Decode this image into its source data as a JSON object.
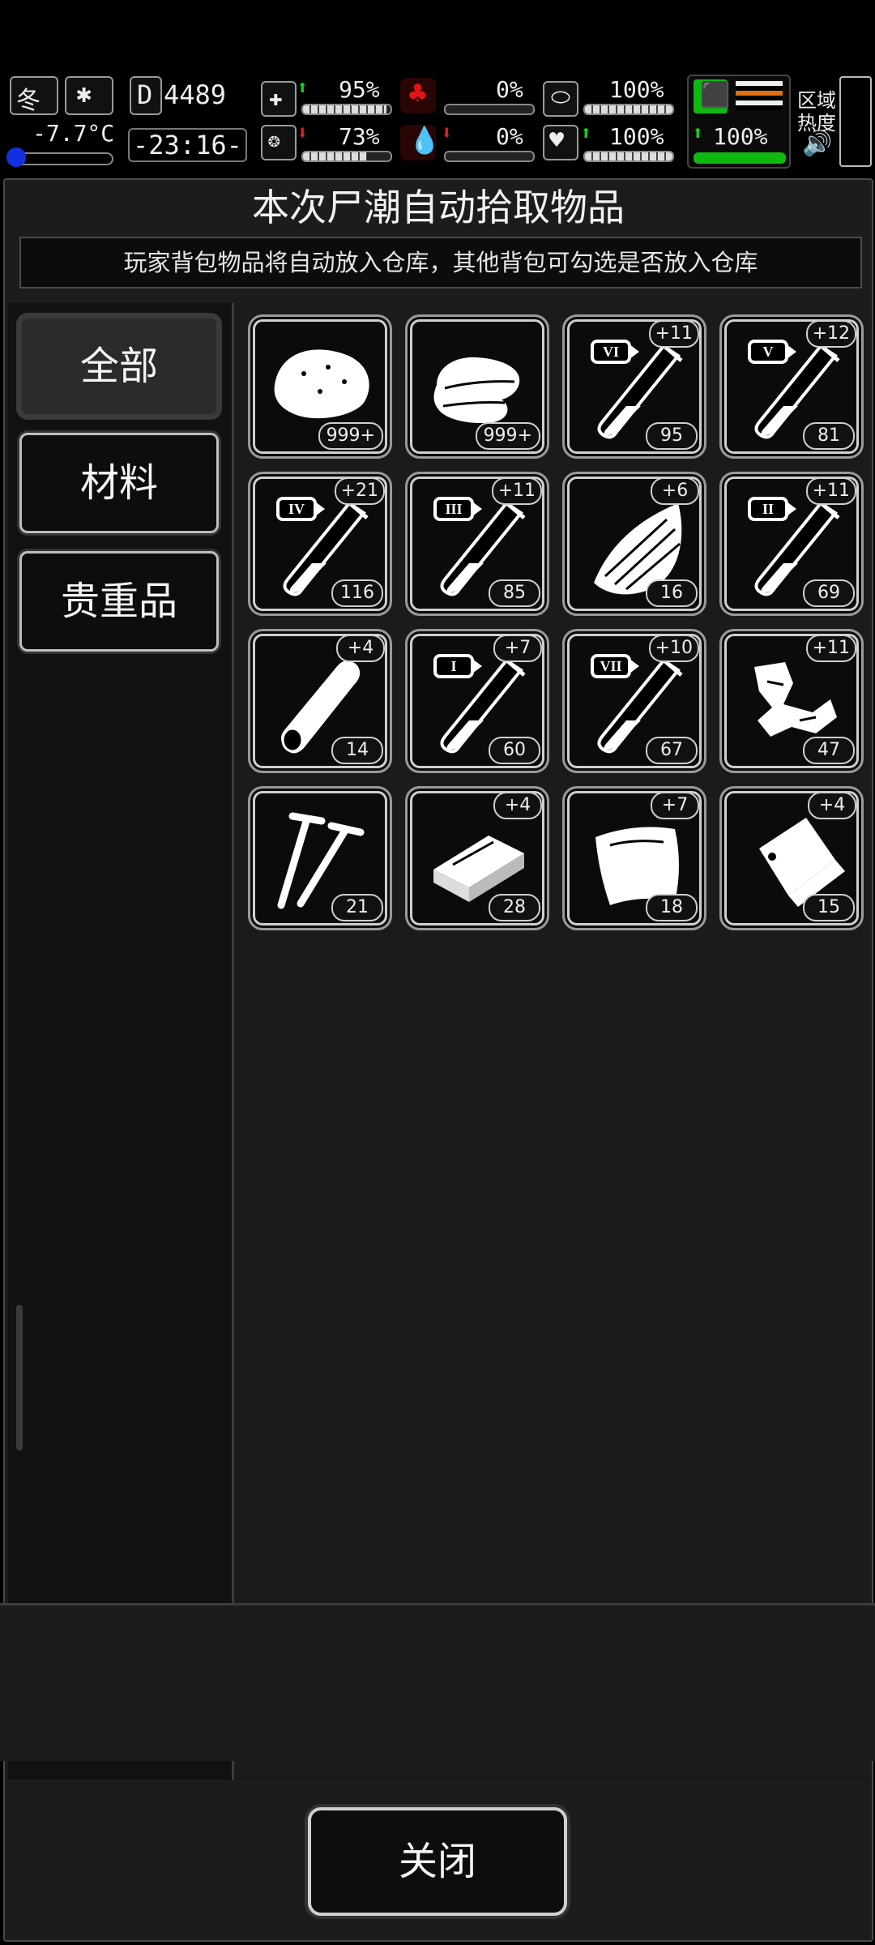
{
  "status": {
    "season": "冬",
    "temperature": "-7.7°C",
    "day_digit": "D",
    "day_count": "4489",
    "time": "-23:16-",
    "medkit_pct": "95%",
    "stomach_pct": "0%",
    "armor_pct": "100%",
    "sanity_pct": "73%",
    "blood_pct": "0%",
    "heart_pct": "100%",
    "stamina_pct": "100%",
    "area_heat_label_1": "区域",
    "area_heat_label_2": "热度"
  },
  "panel": {
    "title": "本次尸潮自动拾取物品",
    "subtitle": "玩家背包物品将自动放入仓库，其他背包可勾选是否放入仓库"
  },
  "tabs": [
    {
      "label": "全部",
      "active": true
    },
    {
      "label": "材料",
      "active": false
    },
    {
      "label": "贵重品",
      "active": false
    }
  ],
  "items": [
    {
      "icon": "meat-icon",
      "count": "999+",
      "plus": ""
    },
    {
      "icon": "cloth-icon",
      "count": "999+",
      "plus": ""
    },
    {
      "icon": "test-tube-vi-icon",
      "roman": "VI",
      "count": "95",
      "plus": "+11"
    },
    {
      "icon": "test-tube-v-icon",
      "roman": "V",
      "count": "81",
      "plus": "+12"
    },
    {
      "icon": "test-tube-iv-icon",
      "roman": "IV",
      "count": "116",
      "plus": "+21"
    },
    {
      "icon": "test-tube-iii-icon",
      "roman": "III",
      "count": "85",
      "plus": "+11"
    },
    {
      "icon": "wood-plank-icon",
      "count": "16",
      "plus": "+6"
    },
    {
      "icon": "test-tube-ii-icon",
      "roman": "II",
      "count": "69",
      "plus": "+11"
    },
    {
      "icon": "wood-log-icon",
      "count": "14",
      "plus": "+4"
    },
    {
      "icon": "test-tube-i-icon",
      "roman": "I",
      "count": "60",
      "plus": "+7"
    },
    {
      "icon": "test-tube-vii-icon",
      "roman": "VII",
      "count": "67",
      "plus": "+10"
    },
    {
      "icon": "scrap-metal-icon",
      "count": "47",
      "plus": "+11"
    },
    {
      "icon": "nails-icon",
      "count": "21",
      "plus": ""
    },
    {
      "icon": "brick-icon",
      "count": "28",
      "plus": "+4"
    },
    {
      "icon": "leather-icon",
      "count": "18",
      "plus": "+7"
    },
    {
      "icon": "bag-icon",
      "count": "15",
      "plus": "+4"
    }
  ],
  "footer": {
    "close_label": "关闭"
  }
}
